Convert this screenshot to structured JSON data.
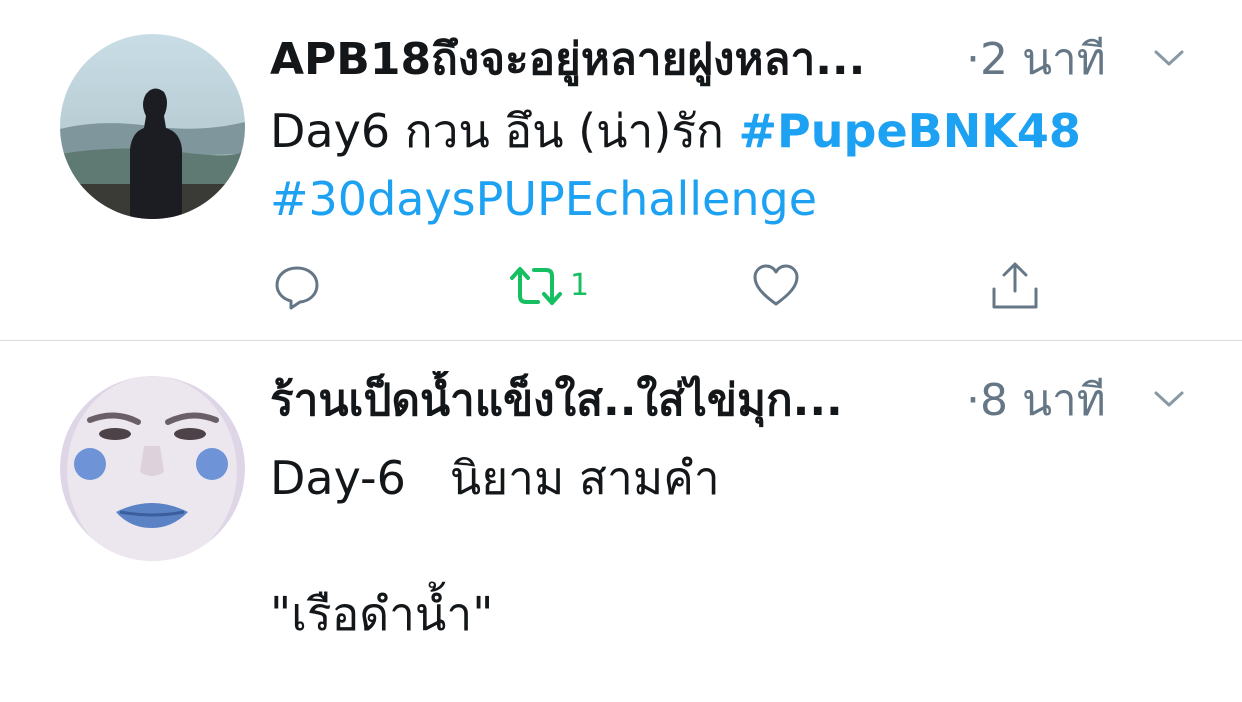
{
  "tweets": [
    {
      "name": "APB18ถึงจะอยู่หลายฝูงหลา...",
      "time": "·2 นาที",
      "text_line1_plain": "Day6 กวน อึน (น่า)รัก ",
      "hashtag1": "#PupeBNK48",
      "hashtag2": "#30daysPUPEchallenge",
      "retweet_count": "1",
      "avatar_icon": "person-silhouette-landscape-avatar"
    },
    {
      "name": "ร้านเป็ดน้ำแข็งใส..ใส่ไข่มุก...",
      "time": "·8 นาที",
      "text_line1": "Day-6   นิยาม สามคำ",
      "text_line2": "\"เรือดำน้ำ\"",
      "avatar_icon": "face-avatar"
    }
  ],
  "colors": {
    "link": "#1da1f2",
    "retweeted": "#17bf63",
    "meta": "#657786",
    "icon": "#657786",
    "divider": "#d8dde2"
  },
  "icons": [
    "reply-icon",
    "retweet-icon",
    "like-icon",
    "share-icon",
    "chevron-down-icon"
  ]
}
